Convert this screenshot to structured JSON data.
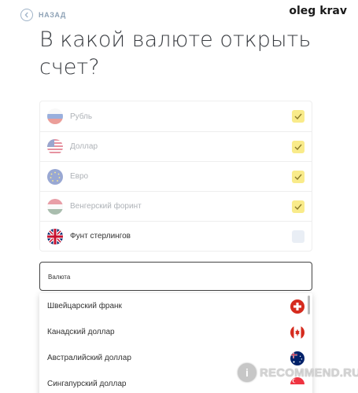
{
  "watermark": {
    "author": "oleg krav",
    "site_text": "RECOMMEND.RU",
    "site_badge": "i"
  },
  "nav": {
    "back_label": "НАЗАД"
  },
  "page": {
    "title": "В какой валюте открыть счет?"
  },
  "currencies": [
    {
      "label": "Рубль",
      "icon": "russia-flag-icon",
      "checked": true
    },
    {
      "label": "Доллар",
      "icon": "usa-flag-icon",
      "checked": true
    },
    {
      "label": "Евро",
      "icon": "eu-flag-icon",
      "checked": true
    },
    {
      "label": "Венгерский форинт",
      "icon": "hungary-flag-icon",
      "checked": true
    },
    {
      "label": "Фунт стерлингов",
      "icon": "uk-flag-icon",
      "checked": false
    }
  ],
  "select": {
    "label": "Валюта"
  },
  "dropdown": {
    "options": [
      {
        "label": "Швейцарский франк",
        "icon": "switzerland-flag-icon"
      },
      {
        "label": "Канадский доллар",
        "icon": "canada-flag-icon"
      },
      {
        "label": "Австралийский доллар",
        "icon": "australia-flag-icon"
      },
      {
        "label": "Сингапурский доллар",
        "icon": "singapore-flag-icon"
      }
    ]
  },
  "colors": {
    "check_on": "#f9eb8a",
    "check_off": "#e9eef5",
    "accent_back": "#8ea2b6"
  }
}
